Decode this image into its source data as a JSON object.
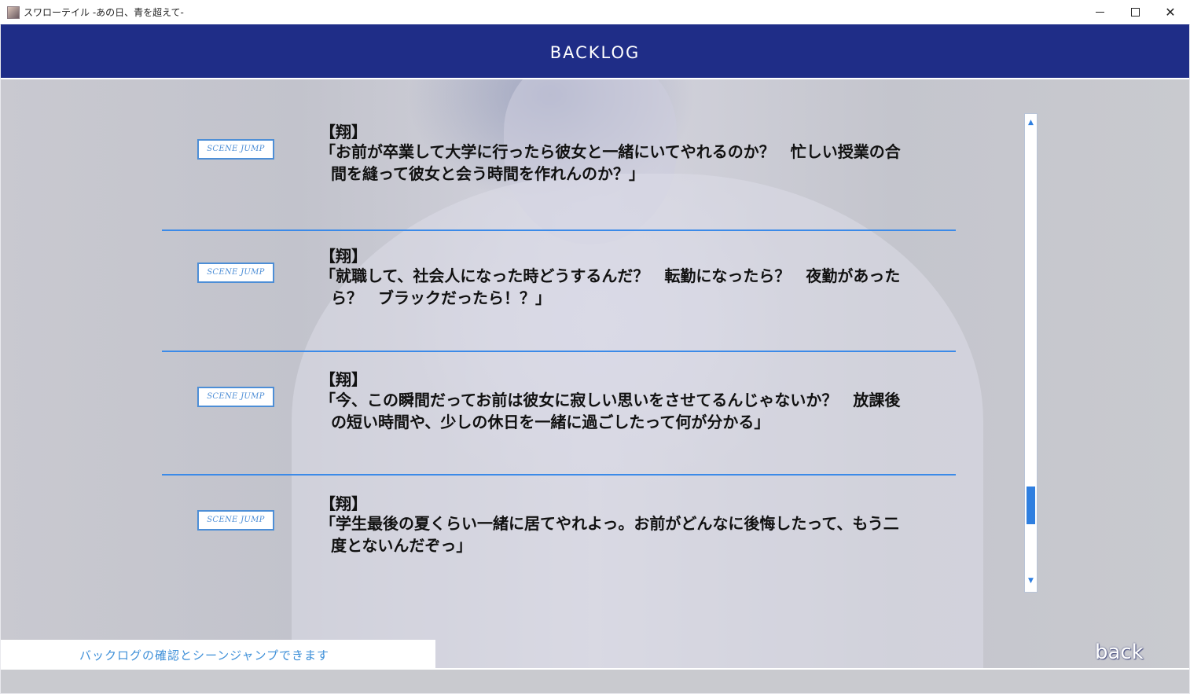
{
  "window": {
    "title": "スワローテイル -あの日、青を超えて-",
    "minimize": "—",
    "maximize": "☐",
    "close": "✕"
  },
  "header": {
    "title": "BACKLOG"
  },
  "entries": [
    {
      "button": "SCENE JUMP",
      "speaker": "【翔】",
      "line1": "「お前が卒業して大学に行ったら彼女と一緒にいてやれるのか？　忙しい授業の合",
      "line2": "間を縫って彼女と会う時間を作れんのか？」"
    },
    {
      "button": "SCENE JUMP",
      "speaker": "【翔】",
      "line1": "「就職して、社会人になった時どうするんだ？　転勤になったら？　夜勤があった",
      "line2": "ら？　ブラックだったら！？」"
    },
    {
      "button": "SCENE JUMP",
      "speaker": "【翔】",
      "line1": "「今、この瞬間だってお前は彼女に寂しい思いをさせてるんじゃないか？　放課後",
      "line2": "の短い時間や、少しの休日を一緒に過ごしたって何が分かる」"
    },
    {
      "button": "SCENE JUMP",
      "speaker": "【翔】",
      "line1": "「学生最後の夏くらい一緒に居てやれよっ。お前がどんなに後悔したって、もう二",
      "line2": "度とないんだぞっ」"
    }
  ],
  "scrollbar": {
    "up": "▲",
    "down": "▼",
    "position_fraction": 0.87
  },
  "footer": {
    "help_text": "バックログの確認とシーンジャンプできます",
    "back_label": "back"
  },
  "colors": {
    "header_bg": "#1f2d87",
    "accent_blue": "#3b8ae8",
    "button_border": "#4d8ed6"
  }
}
